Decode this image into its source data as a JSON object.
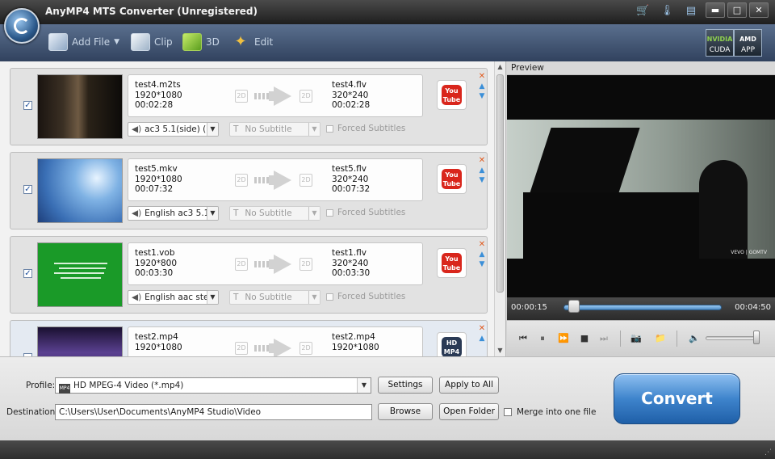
{
  "window": {
    "title": "AnyMP4 MTS Converter (Unregistered)",
    "icons": [
      "cart-icon",
      "thermometer-icon",
      "menu-icon"
    ],
    "buttons": [
      "minimize",
      "maximize",
      "close"
    ]
  },
  "toolbar": {
    "add_file": "Add File",
    "clip": "Clip",
    "three_d": "3D",
    "edit": "Edit",
    "gpu": {
      "cuda": "CUDA",
      "app": "APP",
      "nvidia": "NVIDIA",
      "amd": "AMD"
    }
  },
  "files": [
    {
      "source": {
        "name": "test4.m2ts",
        "resolution": "1920*1080",
        "duration": "00:02:28"
      },
      "output": {
        "name": "test4.flv",
        "resolution": "320*240",
        "duration": "00:02:28"
      },
      "audio": "ac3 5.1(side) (",
      "subtitle": "No Subtitle",
      "forced": "Forced Subtitles",
      "profile_icon": "YouTube",
      "checked": true
    },
    {
      "source": {
        "name": "test5.mkv",
        "resolution": "1920*1080",
        "duration": "00:07:32"
      },
      "output": {
        "name": "test5.flv",
        "resolution": "320*240",
        "duration": "00:07:32"
      },
      "audio": "English ac3 5.1",
      "subtitle": "No Subtitle",
      "forced": "Forced Subtitles",
      "profile_icon": "YouTube",
      "checked": true
    },
    {
      "source": {
        "name": "test1.vob",
        "resolution": "1920*800",
        "duration": "00:03:30"
      },
      "output": {
        "name": "test1.flv",
        "resolution": "320*240",
        "duration": "00:03:30"
      },
      "audio": "English aac ste",
      "subtitle": "No Subtitle",
      "forced": "Forced Subtitles",
      "profile_icon": "YouTube",
      "checked": true
    },
    {
      "source": {
        "name": "test2.mp4",
        "resolution": "1920*1080"
      },
      "output": {
        "name": "test2.mp4",
        "resolution": "1920*1080"
      },
      "profile_icon": "HD MP4"
    }
  ],
  "badge_2d": "2D",
  "preview": {
    "label": "Preview",
    "current_time": "00:00:15",
    "total_time": "00:04:50",
    "progress": 0.05,
    "volume": 0.95,
    "watermark": "VEVO | GOMTV"
  },
  "bottom": {
    "profile_label": "Profile:",
    "profile_tag": "MP4",
    "profile_value": "HD MPEG-4 Video (*.mp4)",
    "settings": "Settings",
    "apply_all": "Apply to All",
    "destination_label": "Destination:",
    "destination_value": "C:\\Users\\User\\Documents\\AnyMP4 Studio\\Video",
    "browse": "Browse",
    "open_folder": "Open Folder",
    "merge": "Merge into one file",
    "convert": "Convert"
  }
}
